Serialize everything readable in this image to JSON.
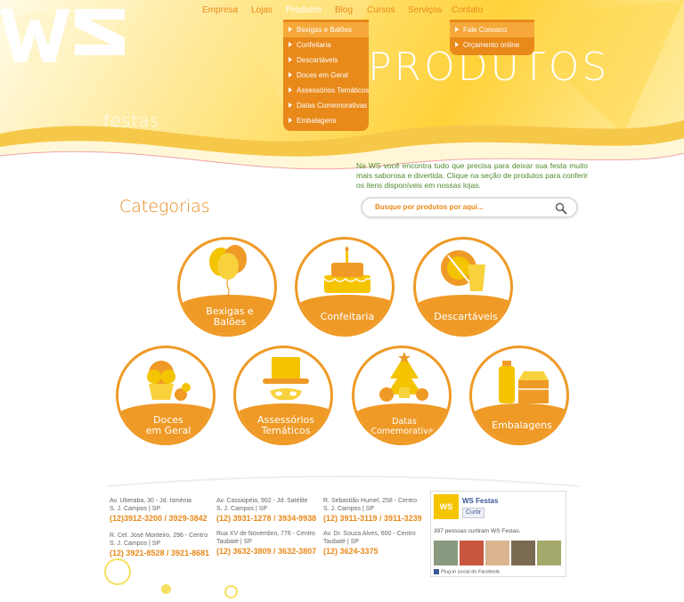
{
  "nav": {
    "items": [
      "Empresa",
      "Lojas",
      "Produtos",
      "Blog",
      "Cursos",
      "Serviços",
      "Contato"
    ],
    "active": "Produtos"
  },
  "products_menu": [
    "Bexigas e Balões",
    "Confeitaria",
    "Descartáveis",
    "Doces em Geral",
    "Assessórios Temáticos",
    "Datas Comemorativas",
    "Embalagens"
  ],
  "contact_menu": [
    "Fale Conosco",
    "Orçamento online"
  ],
  "logo": {
    "mark": "WS",
    "subtitle": "festas"
  },
  "page_title": "PRODUTOS",
  "intro_text": "Na WS você encontra tudo que precisa para deixar sua festa muito mais saborosa e divertida. Clique na seção de produtos para conferir os itens disponíveis em nossas lojas.",
  "categories_heading": "Categorias",
  "search": {
    "placeholder": "Busque por produtos por aqui..."
  },
  "categories": [
    {
      "line1": "Bexigas e",
      "line2": "Balões",
      "icon": "balloons-icon"
    },
    {
      "line1": "Confeitaria",
      "line2": "",
      "icon": "cake-icon"
    },
    {
      "line1": "Descartáveis",
      "line2": "",
      "icon": "plate-cup-icon"
    },
    {
      "line1": "Doces",
      "line2": "em Geral",
      "icon": "cupcake-icon"
    },
    {
      "line1": "Assessórios",
      "line2": "Temáticos",
      "icon": "hat-mask-icon"
    },
    {
      "line1": "Datas",
      "line2": "Comemorativas",
      "icon": "xmas-tree-icon"
    },
    {
      "line1": "Embalagens",
      "line2": "",
      "icon": "packaging-icon"
    }
  ],
  "stores": [
    {
      "line1": "Av. Uberaba, 30 - Jd. Isménia",
      "line2": "S. J. Campos | SP",
      "phone": "(12)3912-3200 / 3929-3842"
    },
    {
      "line1": "Av. Cassiopéia, 902 - Jd. Satélite",
      "line2": "S. J. Campos | SP",
      "phone": "(12) 3931-1278 / 3934-9938"
    },
    {
      "line1": "R. Sebastião Humel, 258 - Centro",
      "line2": "S. J. Campos | SP",
      "phone": "(12) 3911-3119 / 3911-3239"
    },
    {
      "line1": "R. Cel. José Monteiro, 296 - Centro",
      "line2": "S. J. Campos | SP",
      "phone": "(12) 3921-8528 / 3921-8681"
    },
    {
      "line1": "Rua XV de Novembro, 776 - Centro",
      "line2": "Taubaté | SP",
      "phone": "(12) 3632-3809 / 3632-3807"
    },
    {
      "line1": "Av. Dr. Souza Alves, 600 - Centro",
      "line2": "Taubaté | SP",
      "phone": "(12) 3624-3375"
    }
  ],
  "facebook": {
    "logo_text": "WS",
    "page_name": "WS Festas",
    "like_label": "Curtir",
    "likes_text": "397 pessoas curtiram WS Festas.",
    "plugin_text": "Plug-in social do Facebook"
  },
  "colors": {
    "orange": "#ef9a26",
    "yellow": "#ffd23a",
    "green_text": "#4f8a2b",
    "facebook_blue": "#3b5998"
  }
}
